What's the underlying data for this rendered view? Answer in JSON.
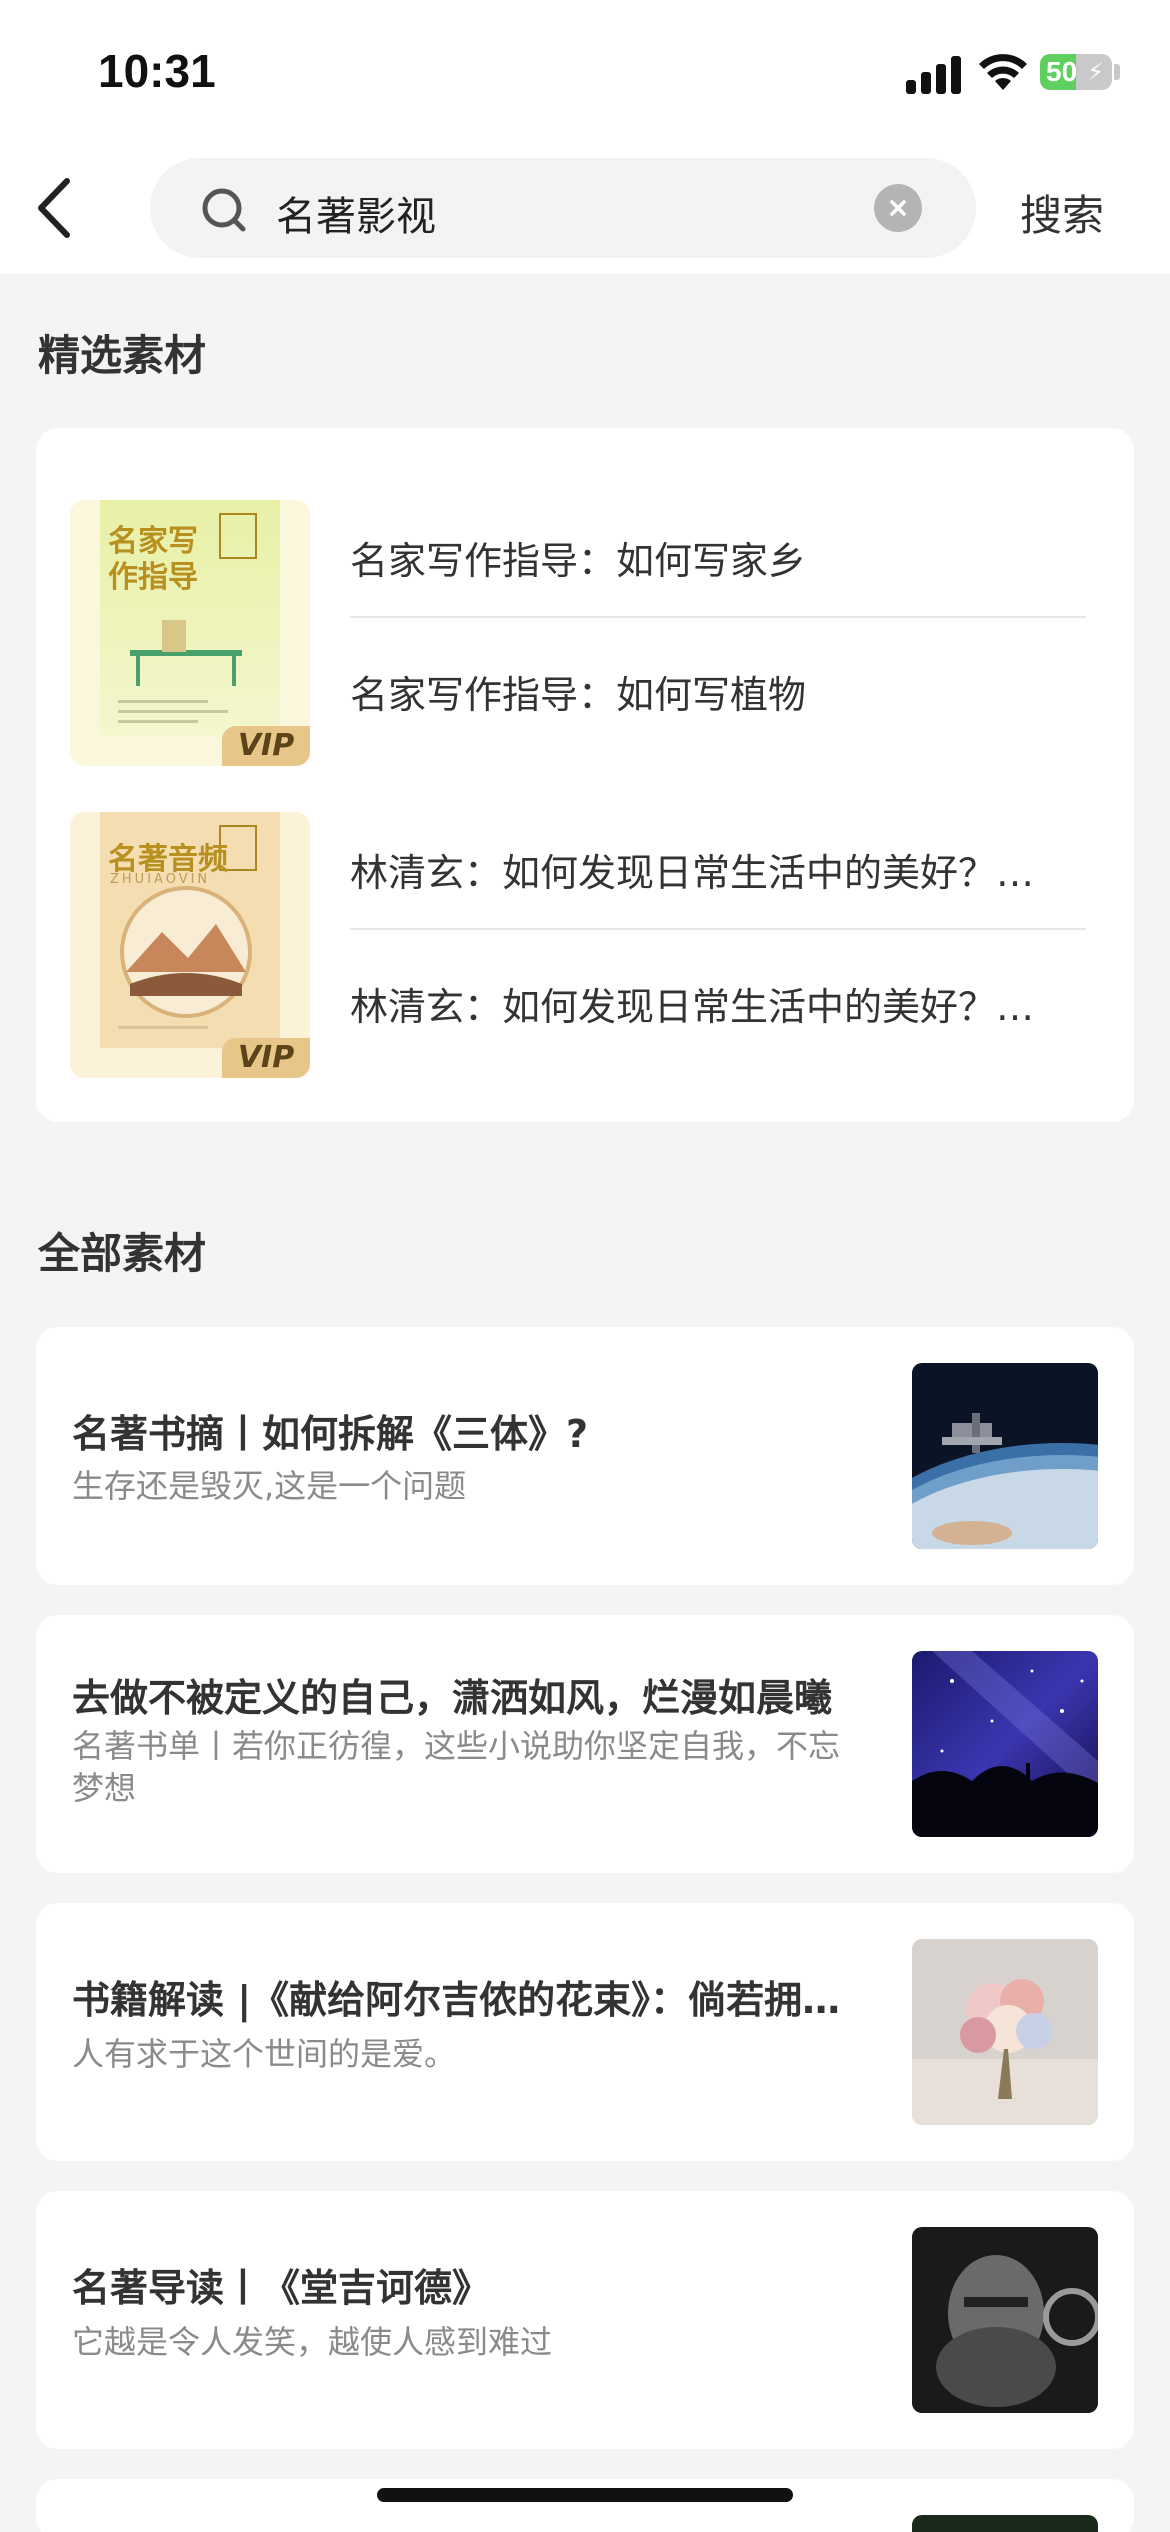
{
  "status_bar": {
    "time": "10:31",
    "battery": "50"
  },
  "search": {
    "query": "名著影视",
    "action_label": "搜索"
  },
  "featured": {
    "title": "精选素材",
    "groups": [
      {
        "vip_badge": "VIP",
        "cover_text": "名家写作指导",
        "lines": [
          "名家写作指导：如何写家乡",
          "名家写作指导：如何写植物"
        ]
      },
      {
        "vip_badge": "VIP",
        "cover_text": "名著音频",
        "cover_sub": "ZHUIAOVIN",
        "lines": [
          "林清玄：如何发现日常生活中的美好？（…",
          "林清玄：如何发现日常生活中的美好？（…"
        ]
      }
    ]
  },
  "all": {
    "title": "全部素材",
    "items": [
      {
        "title": "名著书摘丨如何拆解《三体》?",
        "subtitle": "生存还是毁灭,这是一个问题",
        "thumb": "earth-orbit"
      },
      {
        "title": "去做不被定义的自己，潇洒如风，烂漫如晨曦",
        "subtitle": "名著书单丨若你正彷徨，这些小说助你坚定自我，不忘梦想",
        "thumb": "milky-way"
      },
      {
        "title": "书籍解读 |《献给阿尔吉侬的花束》：倘若拥…",
        "subtitle": "人有求于这个世间的是爱。",
        "thumb": "flower-bouquet"
      },
      {
        "title": "名著导读丨《堂吉诃德》",
        "subtitle": "它越是令人发笑，越使人感到难过",
        "thumb": "knight-helmet"
      }
    ]
  },
  "colors": {
    "background": "#f4f4f4",
    "card": "#ffffff",
    "battery": "#5fd05f"
  }
}
